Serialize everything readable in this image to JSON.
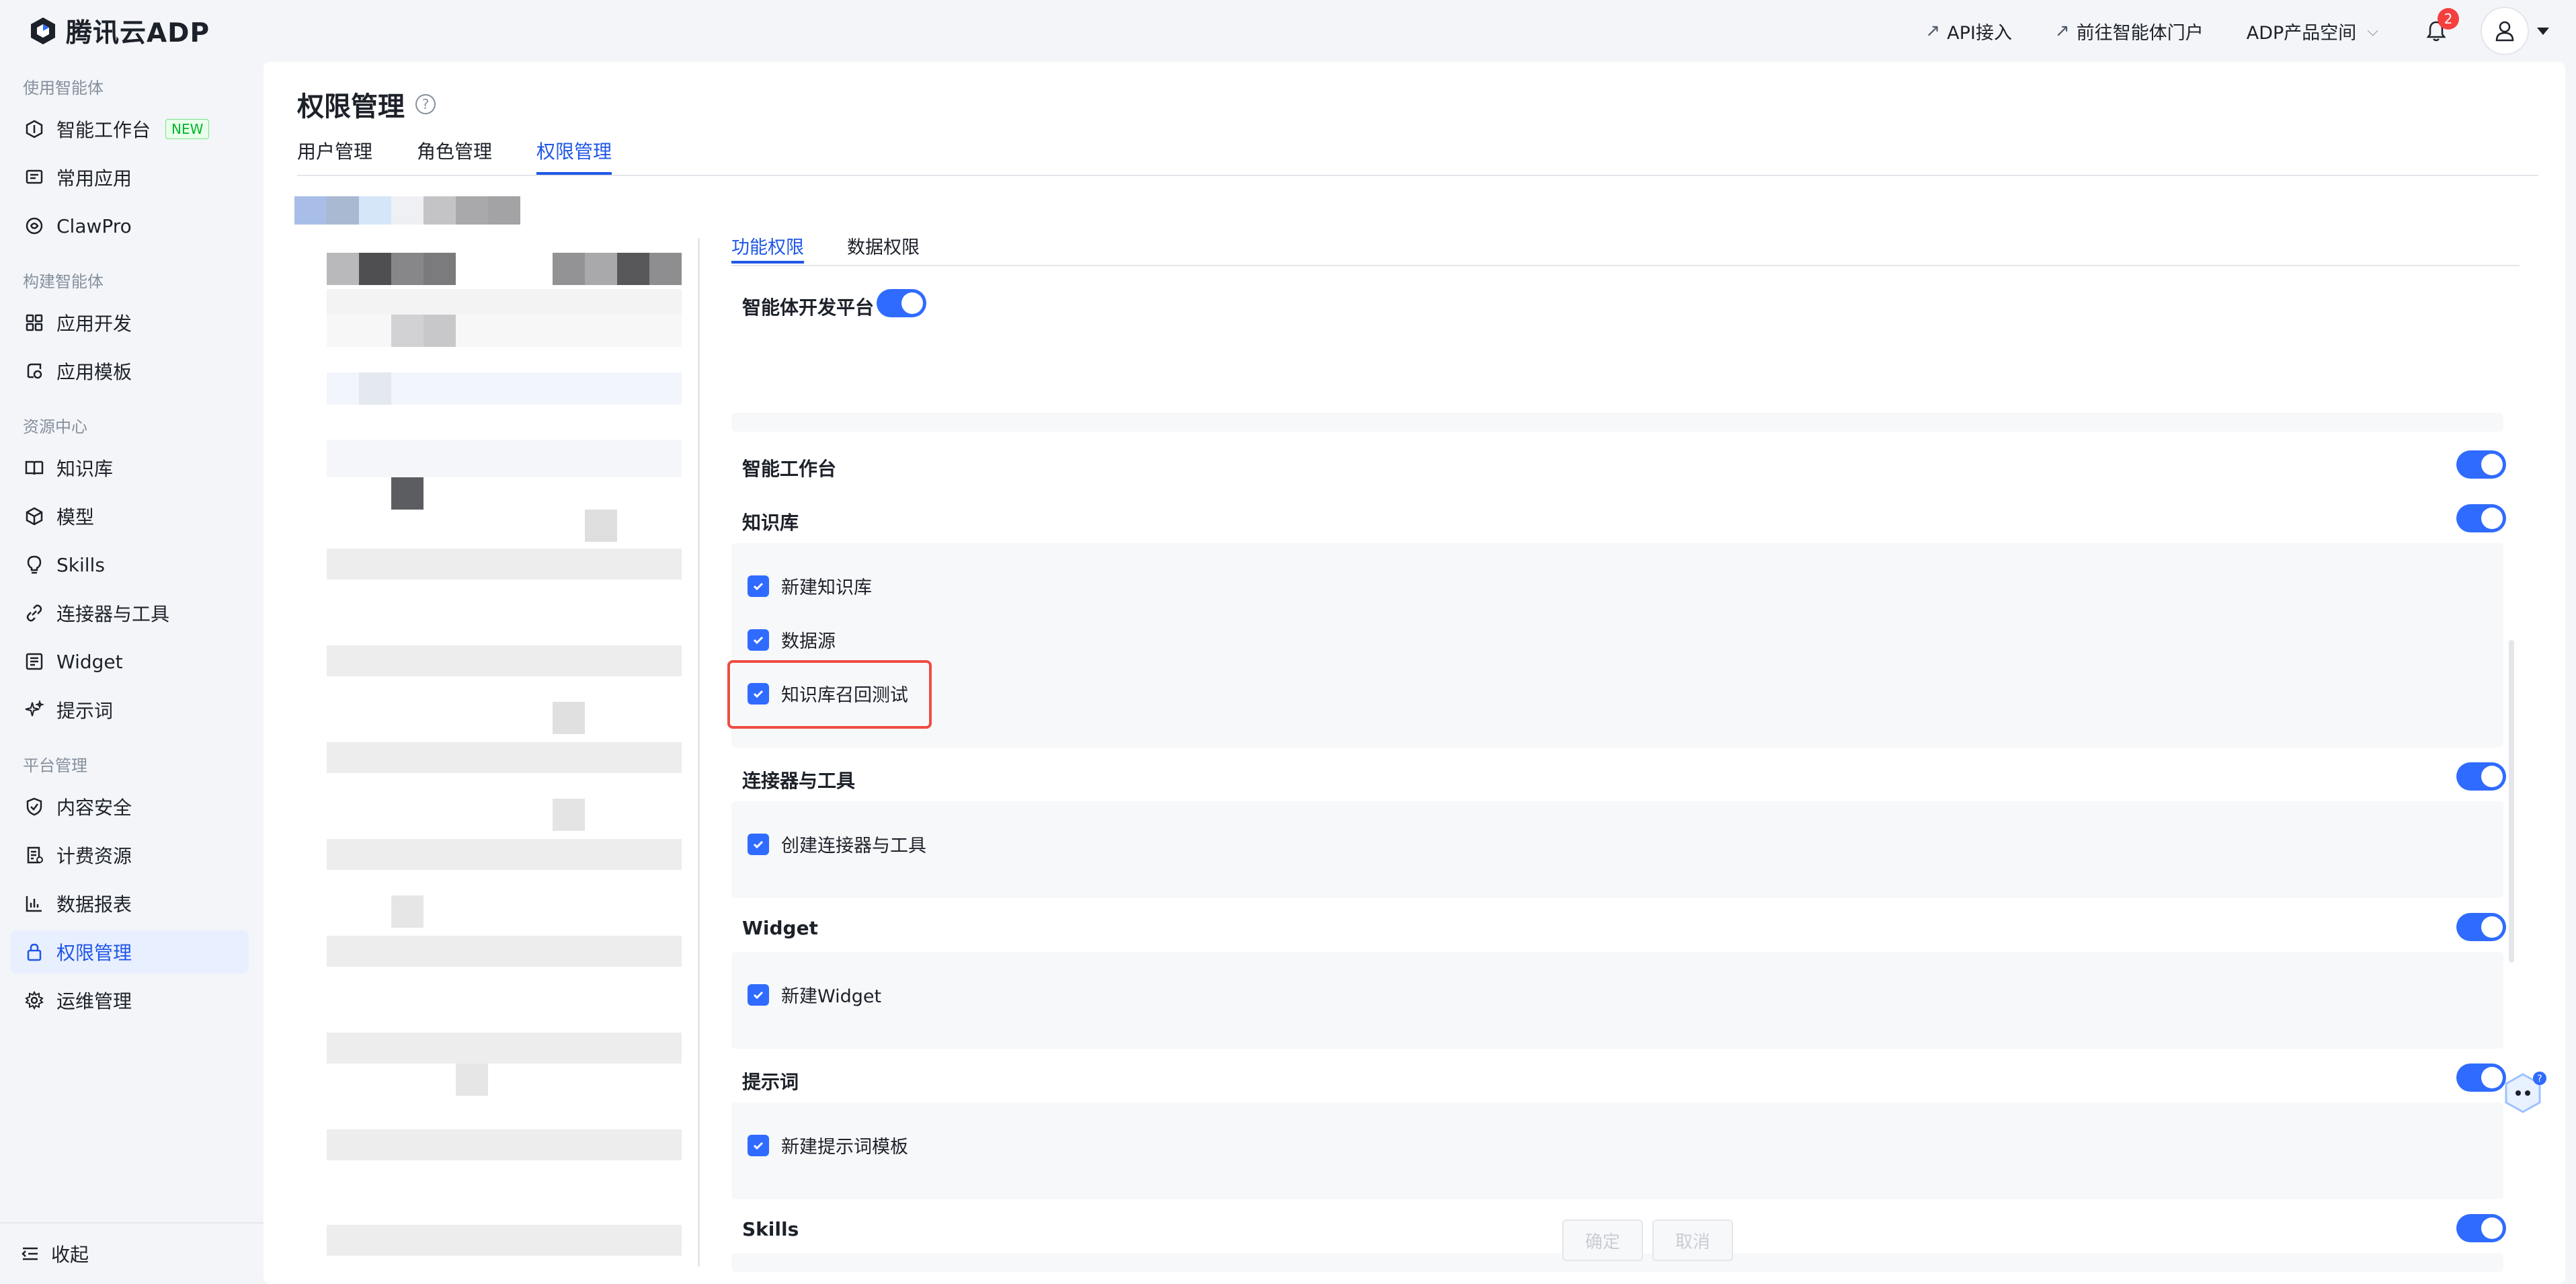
{
  "app": {
    "brand": "腾讯云ADP"
  },
  "topbar": {
    "api_link": "API接入",
    "portal_link": "前往智能体门户",
    "space_label": "ADP产品空间",
    "notification_count": "2"
  },
  "sidebar": {
    "groups": [
      {
        "title": "使用智能体",
        "items": [
          {
            "label": "智能工作台",
            "icon": "dashboard-icon",
            "badge": "NEW"
          },
          {
            "label": "常用应用",
            "icon": "message-icon"
          },
          {
            "label": "ClawPro",
            "icon": "claw-icon"
          }
        ]
      },
      {
        "title": "构建智能体",
        "items": [
          {
            "label": "应用开发",
            "icon": "grid-icon"
          },
          {
            "label": "应用模板",
            "icon": "template-icon"
          }
        ]
      },
      {
        "title": "资源中心",
        "items": [
          {
            "label": "知识库",
            "icon": "book-icon"
          },
          {
            "label": "模型",
            "icon": "cube-icon"
          },
          {
            "label": "Skills",
            "icon": "bulb-icon"
          },
          {
            "label": "连接器与工具",
            "icon": "link-icon"
          },
          {
            "label": "Widget",
            "icon": "widget-icon"
          },
          {
            "label": "提示词",
            "icon": "sparkle-icon"
          }
        ]
      },
      {
        "title": "平台管理",
        "items": [
          {
            "label": "内容安全",
            "icon": "shield-icon"
          },
          {
            "label": "计费资源",
            "icon": "billing-icon"
          },
          {
            "label": "数据报表",
            "icon": "chart-icon"
          },
          {
            "label": "权限管理",
            "icon": "lock-icon",
            "active": true
          },
          {
            "label": "运维管理",
            "icon": "gear-icon"
          }
        ]
      }
    ],
    "collapse_label": "收起"
  },
  "page": {
    "title": "权限管理",
    "tabs": [
      "用户管理",
      "角色管理",
      "权限管理"
    ],
    "active_tab": "权限管理"
  },
  "permissions": {
    "subtabs": [
      "功能权限",
      "数据权限"
    ],
    "active_subtab": "功能权限",
    "platform": {
      "label": "智能体开发平台",
      "enabled": true
    },
    "sections": [
      {
        "label": "智能工作台",
        "enabled": true,
        "items": []
      },
      {
        "label": "知识库",
        "enabled": true,
        "items": [
          {
            "label": "新建知识库",
            "checked": true
          },
          {
            "label": "数据源",
            "checked": true
          },
          {
            "label": "知识库召回测试",
            "checked": true,
            "highlighted": true
          }
        ]
      },
      {
        "label": "连接器与工具",
        "enabled": true,
        "items": [
          {
            "label": "创建连接器与工具",
            "checked": true
          }
        ]
      },
      {
        "label": "Widget",
        "enabled": true,
        "items": [
          {
            "label": "新建Widget",
            "checked": true
          }
        ]
      },
      {
        "label": "提示词",
        "enabled": true,
        "items": [
          {
            "label": "新建提示词模板",
            "checked": true
          }
        ]
      },
      {
        "label": "Skills",
        "enabled": true,
        "items": []
      }
    ],
    "confirm_label": "确定",
    "cancel_label": "取消"
  },
  "colors": {
    "accent": "#1f56e8",
    "toggle_on": "#2f6bff",
    "highlight": "#ee4d43",
    "background": "#f3f5f9"
  }
}
